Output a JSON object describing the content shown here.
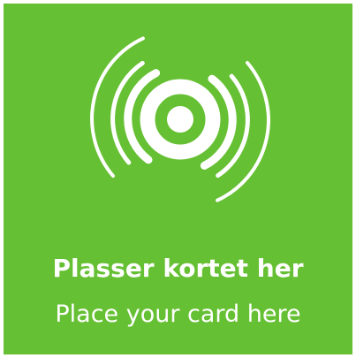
{
  "sign": {
    "background_color": "#66c033",
    "foreground_color": "#ffffff",
    "icon": "contactless-reader-icon",
    "text_norwegian": "Plasser kortet her",
    "text_english": "Place your card here"
  }
}
